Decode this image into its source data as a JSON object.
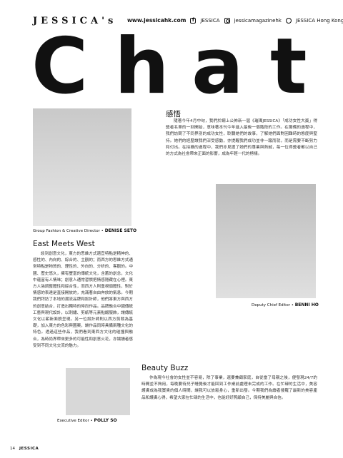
{
  "header": {
    "brand": "JESSICA's",
    "website": "www.jessicahk.com",
    "facebook": "JESSICA",
    "instagram": "jessicamagazinehk",
    "twitter": "JESSICA Hong Kong"
  },
  "title": {
    "letters": [
      "C",
      "h",
      "a",
      "t"
    ]
  },
  "left_column": {
    "photo_caption_role": "Group Fashion & Creative Director • ",
    "photo_caption_name": "DENISE SETO",
    "heading": "East Meets West",
    "body": "談到創意文化，東方的思維方式適宜特點是精神的、感性的、內向的、綜合的、主觀的；而西方的思維方式通常特點是物質的、理性的、外向的、分析的、客觀的。中國、歷史悠久，擁有豐富的傳統文化，含蓄的創念，文化中蘊富有人情味；創意人通常習慣把情感隱藏在心裡。東方人強調整體性和綜合性，而西方人則重視個體性，對於情感的表達是直接開放的，充滿著自由奔放的氣息。今期我們拜訪了本地的潮流品牌和設計師，他們將東方與西方的創意結合，打造出獨特的時尚作品。品牌融合中國傳統工藝與現代設計，以刺繡、剪紙等元素點綴服飾，讓傳統文化以嶄新面貌呈現。另一位設計師則以西方剪裁為基礎，加入東方的色彩與圖案，讓作品同時具備兩種文化的特色。透過這些作品，我們看到東西方文化的碰撞與融合，為時尚界帶來更多的可能性和創意火花，亦讓讀者感受到不同文化交流的魅力。"
  },
  "right_column": {
    "heading": "感悟",
    "body": "隨著今年4月中旬，我們於網上公佈新一屆《璀璨JESSICA》「成功女性大獎」得獎者名單的一刻開始，意味著本刊今年進入最後一個階段的工作。在籌備的過程中，我們訪問了不同界別的成功女性，聆聽她們的故事，了解她們面對困難時的態度與堅持。她們的經歷讓我們深受感動，亦提醒我們成功並非一蹴而就，而是需要不斷努力和付出。在拍攝的過程中，我們亦見證了她們的專業與熱誠，每一位得獎者都以自己的方式為社會帶來正面的影響，成為年輕一代的榜樣。",
    "photo_caption_role": "Deputy Chief Editor • ",
    "photo_caption_name": "BENNI HO"
  },
  "bottom": {
    "heading": "Beauty Buzz",
    "body": "作為現今社會的女性並不容易，除了事業，還要兼顧家庭，自從當了母親之後，便發現24/7的時間並不夠用，每晚要待兒子睡覺後才能回到工作桌前處理未完成的工作。在忙碌的生活中，美容護膚成為我寶貴的個人時間，讓我可以放鬆身心，重新出發。今期我們為讀者搜羅了最新的美容產品和護膚心得，希望大家在忙碌的生活中，也能好好照顧自己，保持美麗與自信。",
    "photo_caption_role": "Executive Editor • ",
    "photo_caption_name": "POLLY SO"
  },
  "footer": {
    "page": "14",
    "magazine": "JESSICA"
  }
}
